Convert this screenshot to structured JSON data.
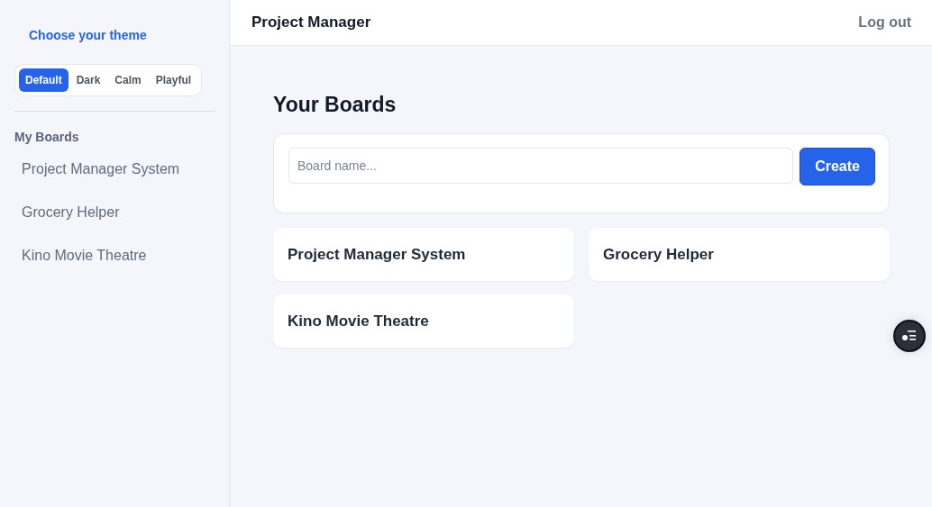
{
  "sidebar": {
    "theme_heading": "Choose your theme",
    "themes": [
      {
        "label": "Default",
        "selected": true
      },
      {
        "label": "Dark",
        "selected": false
      },
      {
        "label": "Calm",
        "selected": false
      },
      {
        "label": "Playful",
        "selected": false
      }
    ],
    "section_title": "My Boards",
    "items": [
      "Project Manager System",
      "Grocery Helper",
      "Kino Movie Theatre"
    ]
  },
  "header": {
    "title": "Project Manager",
    "logout": "Log out"
  },
  "main": {
    "title": "Your Boards",
    "board_field": {
      "placeholder": "Board name..."
    },
    "create_button": "Create",
    "boards": [
      "Project Manager System",
      "Grocery Helper",
      "Kino Movie Theatre"
    ]
  }
}
